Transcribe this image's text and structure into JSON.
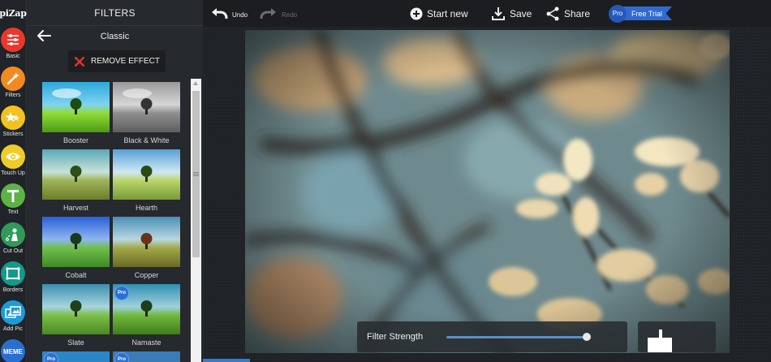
{
  "app": {
    "logo": "piZap"
  },
  "rail": {
    "items": [
      {
        "label": "Basic",
        "color": "#e8392c"
      },
      {
        "label": "Filters",
        "color": "#f28a1f"
      },
      {
        "label": "Stickers",
        "color": "#f2c21e"
      },
      {
        "label": "Touch Up",
        "color": "#f0cd26"
      },
      {
        "label": "Text",
        "color": "#5db246"
      },
      {
        "label": "Cut Out",
        "color": "#2f9a5a"
      },
      {
        "label": "Borders",
        "color": "#149a8a"
      },
      {
        "label": "Add Pic",
        "color": "#1d9bd8"
      },
      {
        "label": "MEME",
        "color": "#2a6fd0"
      }
    ]
  },
  "panel": {
    "title": "FILTERS",
    "subtitle": "Classic",
    "remove_effect": "REMOVE EFFECT",
    "filters": [
      {
        "name": "Booster",
        "pro": false
      },
      {
        "name": "Black & White",
        "pro": false
      },
      {
        "name": "Harvest",
        "pro": false
      },
      {
        "name": "Hearth",
        "pro": false
      },
      {
        "name": "Cobalt",
        "pro": false
      },
      {
        "name": "Copper",
        "pro": false
      },
      {
        "name": "Slate",
        "pro": false
      },
      {
        "name": "Namaste",
        "pro": true
      }
    ],
    "pro_label": "Pro"
  },
  "toolbar": {
    "undo": "Undo",
    "redo": "Redo",
    "start_new": "Start new",
    "save": "Save",
    "share": "Share",
    "pro": "Pro",
    "free_trial": "Free Trial"
  },
  "editor": {
    "filter_strength_label": "Filter Strength",
    "filter_strength": 0.97
  }
}
